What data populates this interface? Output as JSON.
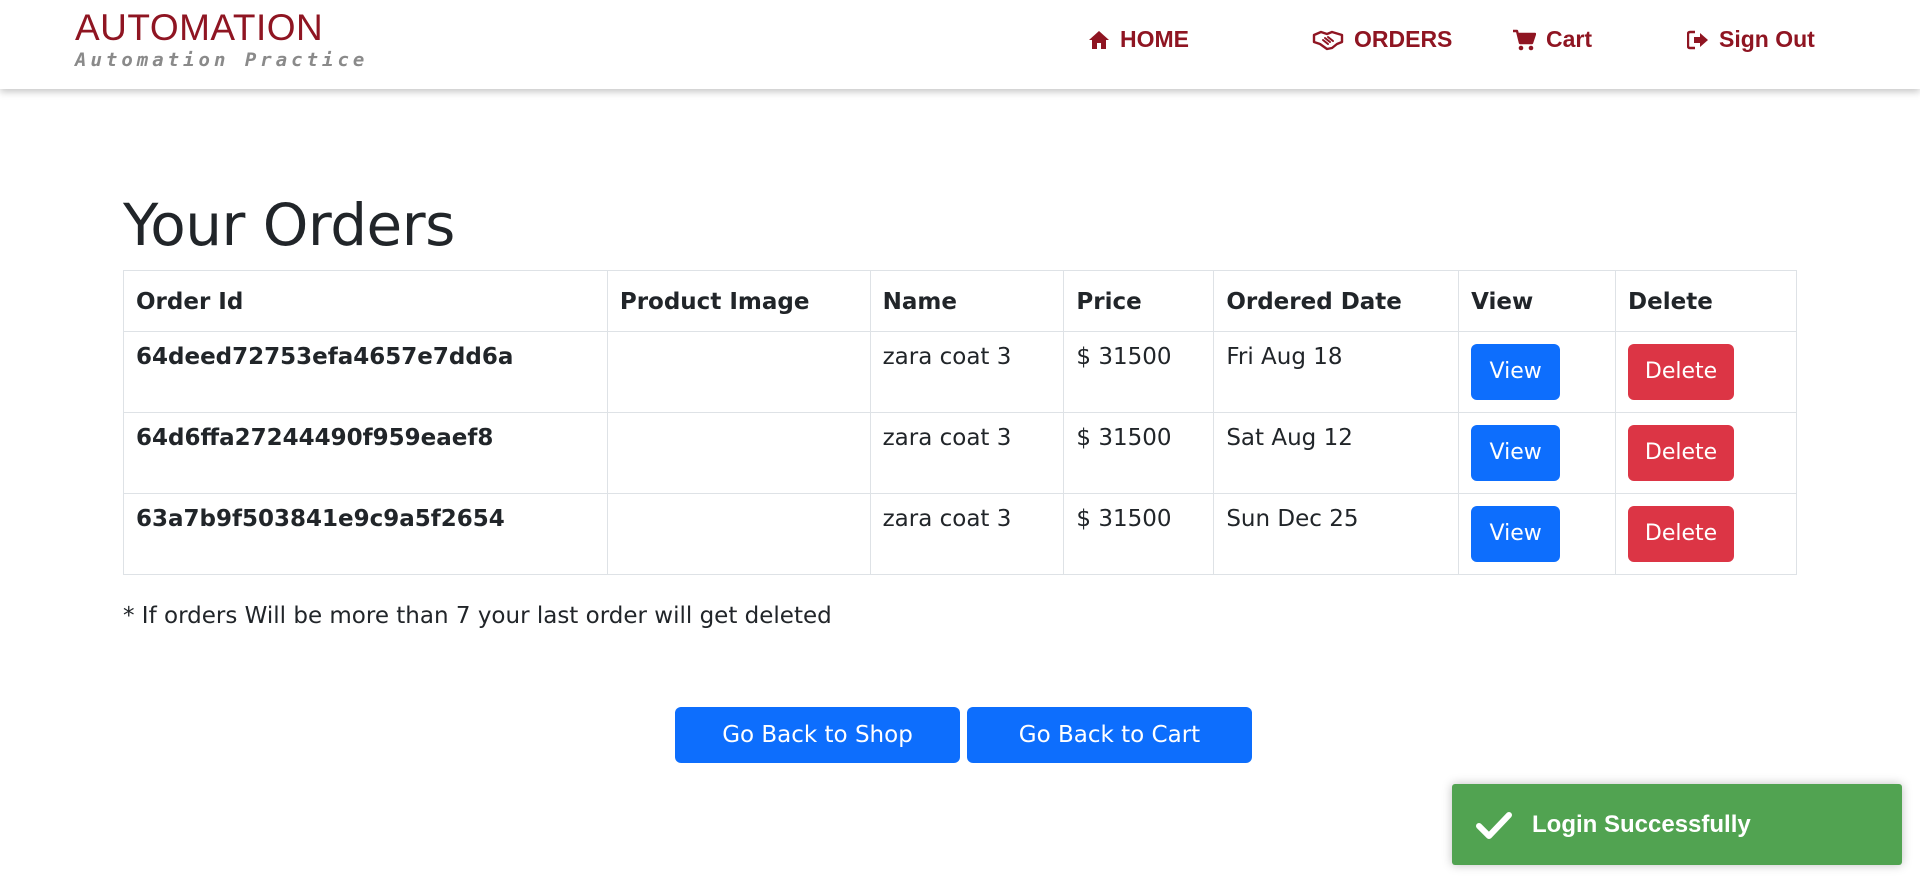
{
  "brand": {
    "title": "AUTOMATION",
    "subtitle": "Automation Practice",
    "color": "#8f1522"
  },
  "nav": {
    "home": {
      "label": "HOME",
      "icon": "home-icon"
    },
    "orders": {
      "label": "ORDERS",
      "icon": "handshake-icon"
    },
    "cart": {
      "label": "Cart",
      "icon": "cart-icon"
    },
    "signout": {
      "label": "Sign Out",
      "icon": "sign-out-icon"
    }
  },
  "page": {
    "title": "Your Orders",
    "note": "* If orders Will be more than 7 your last order will get deleted"
  },
  "table": {
    "headers": [
      "Order Id",
      "Product Image",
      "Name",
      "Price",
      "Ordered Date",
      "View",
      "Delete"
    ],
    "rows": [
      {
        "order_id": "64deed72753efa4657e7dd6a",
        "product_image": "",
        "name": "zara coat 3",
        "price": "$ 31500",
        "date": "Fri Aug 18",
        "view_label": "View",
        "delete_label": "Delete"
      },
      {
        "order_id": "64d6ffa27244490f959eaef8",
        "product_image": "",
        "name": "zara coat 3",
        "price": "$ 31500",
        "date": "Sat Aug 12",
        "view_label": "View",
        "delete_label": "Delete"
      },
      {
        "order_id": "63a7b9f503841e9c9a5f2654",
        "product_image": "",
        "name": "zara coat 3",
        "price": "$ 31500",
        "date": "Sun Dec 25",
        "view_label": "View",
        "delete_label": "Delete"
      }
    ]
  },
  "actions": {
    "back_to_shop": "Go Back to Shop",
    "back_to_cart": "Go Back to Cart"
  },
  "toast": {
    "message": "Login Successfully",
    "icon": "check-icon",
    "color": "#51a351"
  },
  "colors": {
    "primary": "#0d6efd",
    "danger": "#dc3545"
  }
}
